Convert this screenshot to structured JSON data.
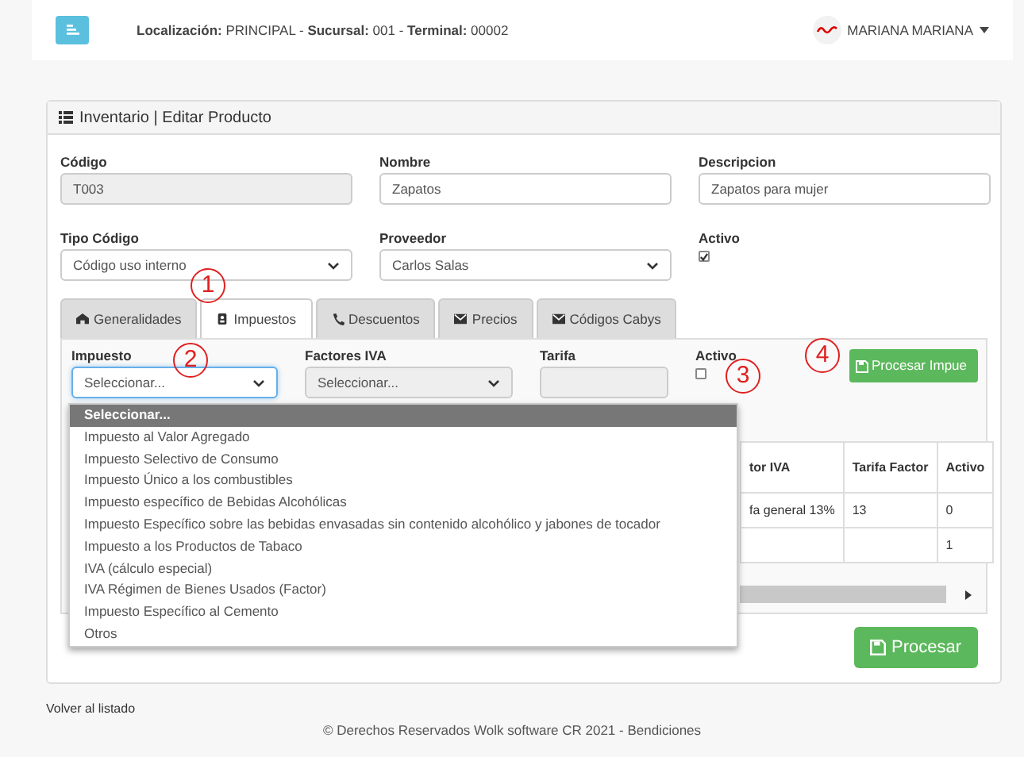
{
  "header": {
    "info": "**Localización:** PRINCIPAL - **Sucursal:** 001 - **Terminal:** 00002",
    "user": "MARIANA MARIANA"
  },
  "card": {
    "title": "Inventario | Editar Producto"
  },
  "fields": [
    {
      "kind": "text",
      "label": "Código",
      "value": "T003",
      "disabled": true
    },
    {
      "kind": "text",
      "label": "Nombre",
      "value": "Zapatos",
      "disabled": false
    },
    {
      "kind": "text",
      "label": "Descripcion",
      "value": "Zapatos para mujer",
      "disabled": false
    },
    {
      "kind": "select",
      "label": "Tipo Código",
      "value": "Código uso interno",
      "disabled": false
    },
    {
      "kind": "select",
      "label": "Proveedor",
      "value": "Carlos Salas",
      "disabled": false
    },
    {
      "kind": "checkbox",
      "label": "Activo",
      "checked": true
    }
  ],
  "tabs": [
    {
      "label": "Generalidades",
      "selected": false
    },
    {
      "label": "Impuestos",
      "selected": true
    },
    {
      "label": "Descuentos",
      "selected": false
    },
    {
      "label": "Precios",
      "selected": false
    },
    {
      "label": "Códigos Cabys",
      "selected": false
    }
  ],
  "tax_form": [
    {
      "kind": "select",
      "label": "Impuesto",
      "value": "Seleccionar...",
      "disabled": false,
      "focused": true
    },
    {
      "kind": "select",
      "label": "Factores IVA",
      "value": "Seleccionar...",
      "disabled": true,
      "focused": false
    },
    {
      "kind": "text",
      "label": "Tarifa",
      "disabled": true,
      "focused": false
    },
    {
      "kind": "checkbox",
      "label": "Activo",
      "checked": false
    }
  ],
  "process_tax_button": "Procesar Impue",
  "dropdown": [
    {
      "label": "Seleccionar...",
      "selected": true
    },
    {
      "label": "Impuesto al Valor Agregado",
      "selected": false
    },
    {
      "label": "Impuesto Selectivo de Consumo",
      "selected": false
    },
    {
      "label": "Impuesto Único a los combustibles",
      "selected": false
    },
    {
      "label": "Impuesto específico de Bebidas Alcohólicas",
      "selected": false
    },
    {
      "label": "Impuesto Específico sobre las bebidas envasadas sin contenido alcohólico y jabones de tocador",
      "selected": false
    },
    {
      "label": "Impuesto a los Productos de Tabaco",
      "selected": false
    },
    {
      "label": "IVA (cálculo especial)",
      "selected": false
    },
    {
      "label": "IVA Régimen de Bienes Usados (Factor)",
      "selected": false
    },
    {
      "label": "Impuesto Específico al Cemento",
      "selected": false
    },
    {
      "label": "Otros",
      "selected": false
    }
  ],
  "table": {
    "columns": [
      "tor IVA",
      "Tarifa Factor",
      "Activo"
    ],
    "rows": [
      [
        "fa general 13%",
        "13",
        "0"
      ],
      [
        "",
        "",
        "1"
      ]
    ]
  },
  "save_button": "Procesar",
  "back_link": "Volver al listado",
  "footer": "©  Derechos Reservados Wolk software CR  2021 - Bendiciones",
  "annotations": [
    "1",
    "2",
    "3",
    "4"
  ]
}
